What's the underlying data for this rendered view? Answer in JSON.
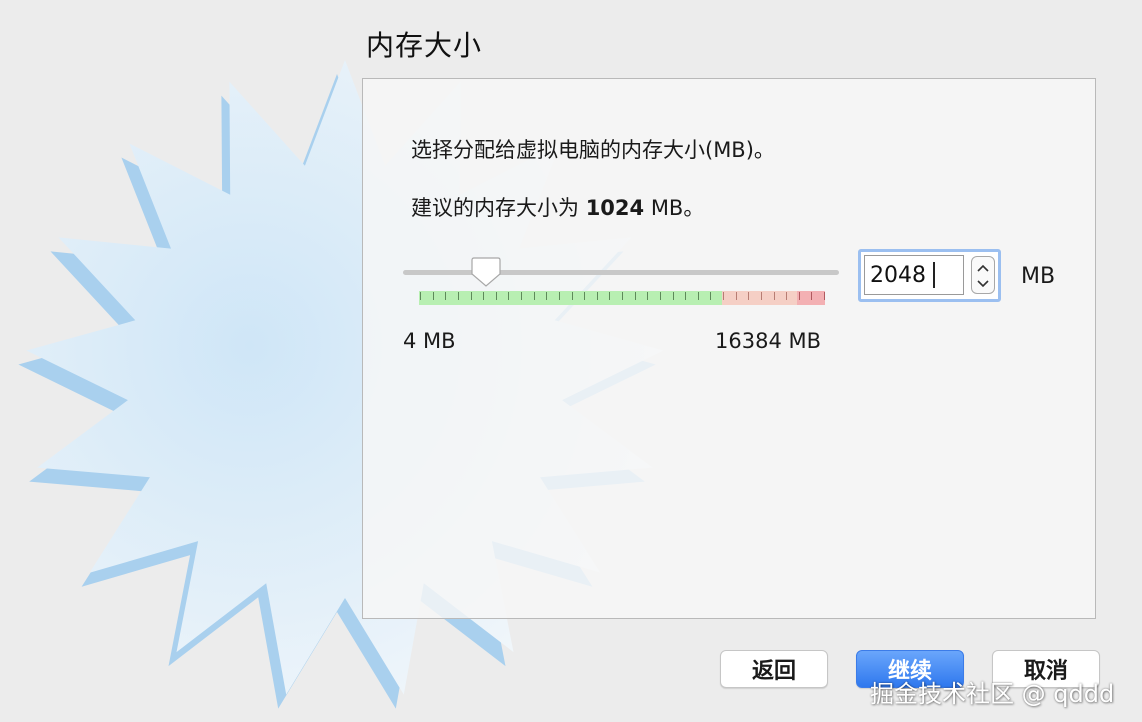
{
  "page": {
    "title": "内存大小"
  },
  "panel": {
    "prompt": "选择分配给虚拟电脑的内存大小(MB)。",
    "recommend_prefix": "建议的内存大小为 ",
    "recommend_value": "1024",
    "recommend_suffix": " MB。"
  },
  "memory_slider": {
    "min_label": "4 MB",
    "max_label": "16384 MB",
    "min_value": 4,
    "max_value": 16384,
    "value": 2048
  },
  "memory_input": {
    "value": "2048",
    "unit": "MB"
  },
  "buttons": {
    "back": "返回",
    "continue": "继续",
    "cancel": "取消"
  },
  "watermark": {
    "text": "掘金技术社区 @ qddd"
  },
  "colors": {
    "accent": "#2f78ee",
    "safe_range": "#b8efb2",
    "warn_range": "#f5cfc5",
    "danger_range": "#f3b0b3"
  }
}
